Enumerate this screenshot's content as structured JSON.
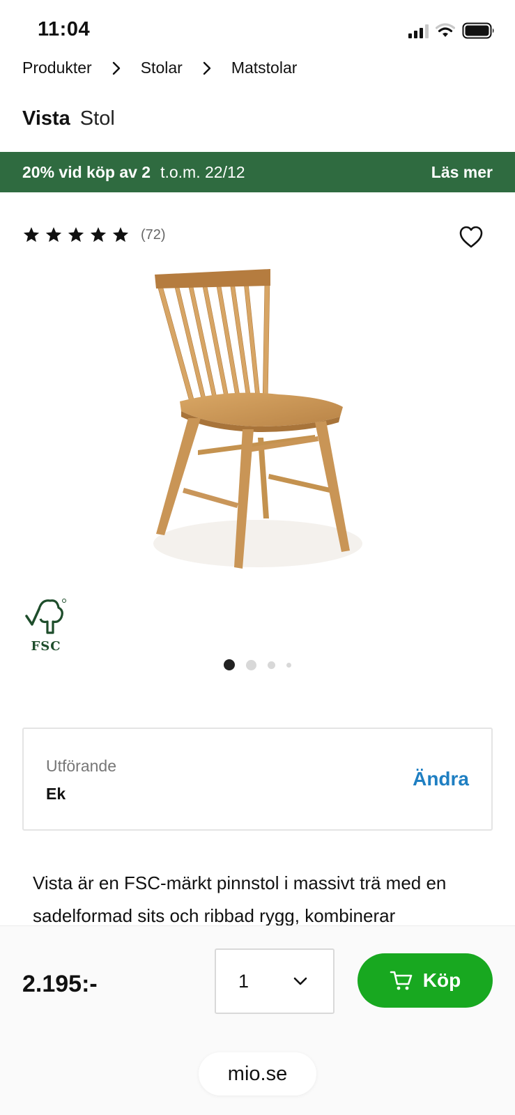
{
  "status_bar": {
    "time": "11:04",
    "icons": [
      "cellular-signal-icon",
      "wifi-icon",
      "battery-icon"
    ]
  },
  "breadcrumb": {
    "items": [
      "Produkter",
      "Stolar",
      "Matstolar"
    ],
    "separator_icon": "chevron-right-icon"
  },
  "product": {
    "name": "Vista",
    "type": "Stol"
  },
  "promo": {
    "headline": "20% vid köp av 2",
    "date": "t.o.m. 22/12",
    "link": "Läs mer",
    "background_color": "#2f6b40"
  },
  "rating": {
    "stars": 5,
    "count": "(72)",
    "star_icon": "star-icon",
    "favorite_icon": "heart-icon"
  },
  "image": {
    "subject": "chair-image",
    "badge_text": "FSC",
    "carousel_dots": 4,
    "active_dot": 0
  },
  "variant": {
    "label": "Utförande",
    "value": "Ek",
    "change_label": "Ändra",
    "link_color": "#1f7fc2"
  },
  "description": {
    "line1": "Vista är en FSC-märkt pinnstol i massivt trä med en",
    "line2": "sadelformad sits och ribbad rygg, kombinerar"
  },
  "purchase": {
    "price": "2.195:-",
    "quantity": "1",
    "buy_label": "Köp",
    "buy_color": "#18a820"
  },
  "browser": {
    "url": "mio.se"
  }
}
